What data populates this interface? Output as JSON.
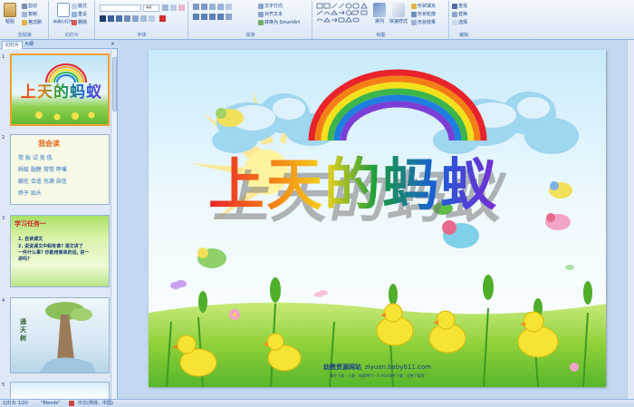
{
  "ribbon": {
    "clipboard": {
      "label": "剪贴板",
      "paste": "粘贴",
      "cut": "剪切",
      "copy": "复制",
      "format_painter": "格式刷"
    },
    "slides": {
      "label": "幻灯片",
      "new_slide": "新建幻灯片",
      "layout": "版式",
      "reset": "重设",
      "delete": "删除"
    },
    "font": {
      "label": "字体",
      "font_name": "",
      "font_size": "44"
    },
    "paragraph": {
      "label": "段落",
      "text_direction": "文字方向",
      "align_text": "对齐文本",
      "smartart": "转换为 SmartArt"
    },
    "drawing": {
      "label": "绘图",
      "arrange": "排列",
      "quick_styles": "快速样式",
      "fill": "形状填充",
      "outline": "形状轮廓",
      "effects": "形状效果"
    },
    "editing": {
      "label": "编辑",
      "find": "查找",
      "replace": "替换",
      "select": "选择"
    }
  },
  "panel": {
    "tabs": [
      "幻灯片",
      "大纲"
    ],
    "close": "×",
    "slide_numbers": [
      "1",
      "2",
      "3",
      "4",
      "5"
    ]
  },
  "thumbs": {
    "t1_title": "上天的蚂蚁",
    "t2_title": "我会读",
    "t2_rows": [
      "常 抬 试 竞 低",
      "蚂蚁 翅膀 常常 呼噗",
      "躺在 合适 充满 自信",
      "终于 抬头"
    ],
    "t3_title": "学习任务一",
    "t3_lines": [
      "1. 自读课文",
      "2. 说说课文中蚂有谁? 课文讲了",
      "一件什么事? 你能用简单的话, 讲一",
      "讲吗?"
    ],
    "t4_title": "通天树"
  },
  "slide": {
    "title": "上天的蚂蚁",
    "site_name": "幼教资源网站",
    "site_url": "ziyuan.baby611.com",
    "site_links": "课件下载 · 儿歌 · 故事MP3 · FLASH课件下载 · 试卷下载等"
  },
  "status": {
    "slide_counter": "幻灯片 1/20",
    "theme": "\"Blends\"",
    "language": "中文(简体，中国)"
  },
  "colors": {
    "title_gradient": [
      "#e8232a",
      "#f57f17",
      "#f3d21b",
      "#1b9d3b",
      "#1a5fd6",
      "#7b2ad6"
    ],
    "selection": "#f0a030",
    "ribbon_text": "#15428b"
  }
}
